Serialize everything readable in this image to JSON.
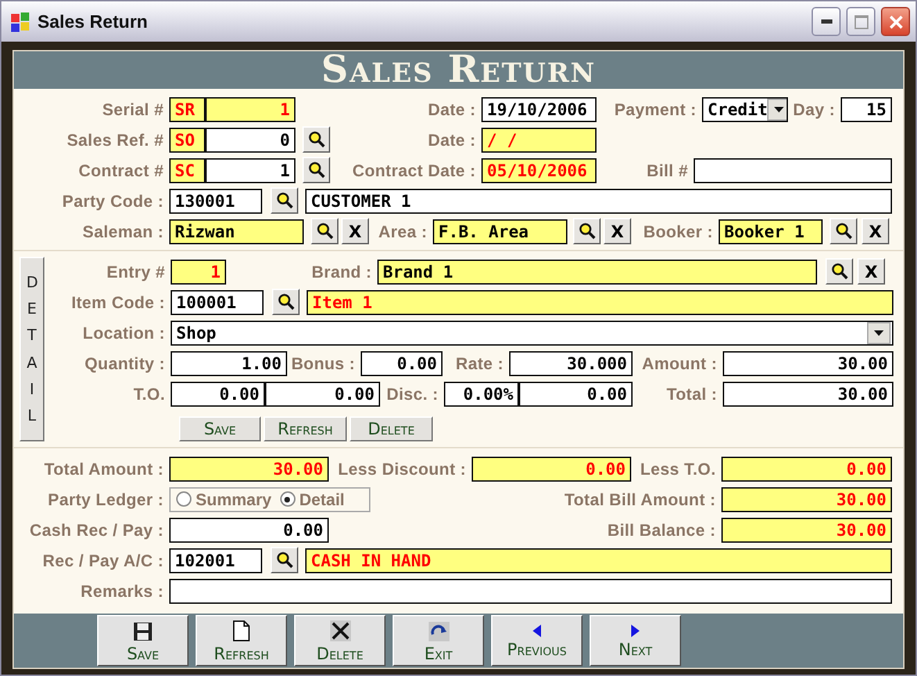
{
  "window": {
    "title": "Sales Return"
  },
  "header": {
    "title": "Sales Return"
  },
  "master": {
    "serial": {
      "label": "Serial #",
      "prefix": "SR",
      "value": "1"
    },
    "date": {
      "label": "Date :",
      "value": "19/10/2006"
    },
    "payment": {
      "label": "Payment :",
      "value": "Credit"
    },
    "day": {
      "label": "Day :",
      "value": "15"
    },
    "sales_ref": {
      "label": "Sales Ref. #",
      "prefix": "SO",
      "value": "0"
    },
    "ref_date": {
      "label": "Date :",
      "value": "/ /"
    },
    "contract": {
      "label": "Contract #",
      "prefix": "SC",
      "value": "1"
    },
    "contract_date": {
      "label": "Contract Date :",
      "value": "05/10/2006"
    },
    "bill": {
      "label": "Bill #"
    },
    "party": {
      "label": "Party Code :",
      "code": "130001",
      "name": "CUSTOMER 1"
    },
    "saleman": {
      "label": "Saleman :",
      "value": "Rizwan",
      "clear": "X"
    },
    "area": {
      "label": "Area :",
      "value": "F.B. Area",
      "clear": "X"
    },
    "booker": {
      "label": "Booker :",
      "value": "Booker 1",
      "clear": "X"
    }
  },
  "detail": {
    "tab": "DETAIL",
    "entry": {
      "label": "Entry #",
      "value": "1"
    },
    "brand": {
      "label": "Brand :",
      "value": "Brand 1",
      "clear": "X"
    },
    "item": {
      "label": "Item Code :",
      "code": "100001",
      "name": "Item 1"
    },
    "location": {
      "label": "Location :",
      "value": "Shop"
    },
    "quantity": {
      "label": "Quantity :",
      "value": "1.00"
    },
    "bonus": {
      "label": "Bonus :",
      "value": "0.00"
    },
    "rate": {
      "label": "Rate :",
      "value": "30.000"
    },
    "amount": {
      "label": "Amount :",
      "value": "30.00"
    },
    "to": {
      "label": "T.O.",
      "values": [
        "0.00",
        "0.00"
      ]
    },
    "disc": {
      "label": "Disc. :",
      "values": [
        "0.00%",
        "0.00"
      ]
    },
    "total": {
      "label": "Total :",
      "value": "30.00"
    },
    "buttons": [
      "Save",
      "Refresh",
      "Delete"
    ]
  },
  "summary": {
    "total_amount": {
      "label": "Total Amount :",
      "value": "30.00"
    },
    "less_discount": {
      "label": "Less Discount :",
      "value": "0.00"
    },
    "less_to": {
      "label": "Less T.O.",
      "value": "0.00"
    },
    "party_ledger": {
      "label": "Party Ledger :",
      "options": [
        {
          "label": "Summary",
          "selected": false
        },
        {
          "label": "Detail",
          "selected": true
        }
      ]
    },
    "total_bill": {
      "label": "Total Bill Amount :",
      "value": "30.00"
    },
    "cash": {
      "label": "Cash Rec / Pay :",
      "value": "0.00"
    },
    "bill_balance": {
      "label": "Bill Balance :",
      "value": "30.00"
    },
    "account": {
      "label": "Rec / Pay A/C :",
      "code": "102001",
      "name": "CASH IN HAND"
    },
    "remarks": {
      "label": "Remarks :"
    }
  },
  "toolbar": [
    {
      "kind": "save",
      "label": "Save"
    },
    {
      "kind": "refresh",
      "label": "Refresh"
    },
    {
      "kind": "delete",
      "label": "Delete"
    },
    {
      "kind": "exit",
      "label": "Exit"
    },
    {
      "kind": "previous",
      "label": "Previous"
    },
    {
      "kind": "next",
      "label": "Next"
    }
  ]
}
